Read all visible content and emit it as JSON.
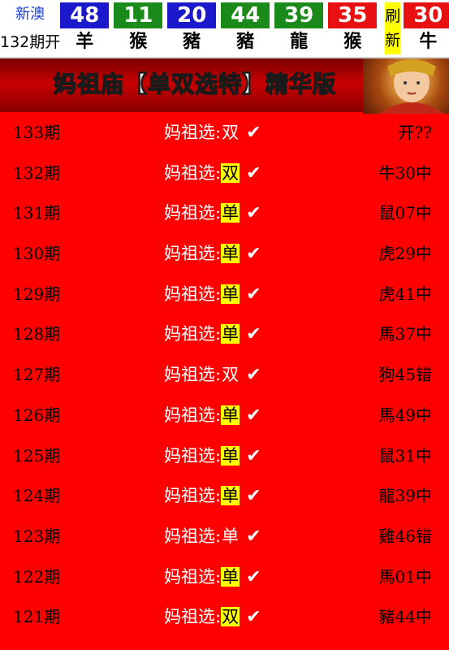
{
  "lottery": {
    "region": "新澳",
    "period": "132期开",
    "balls": [
      {
        "num": "48",
        "zodiac": "羊",
        "color": "blue"
      },
      {
        "num": "11",
        "zodiac": "猴",
        "color": "green"
      },
      {
        "num": "20",
        "zodiac": "豬",
        "color": "blue"
      },
      {
        "num": "44",
        "zodiac": "豬",
        "color": "green"
      },
      {
        "num": "39",
        "zodiac": "龍",
        "color": "green"
      },
      {
        "num": "35",
        "zodiac": "猴",
        "color": "red"
      }
    ],
    "refresh_top": "刷",
    "refresh_bottom": "新",
    "special": {
      "num": "30",
      "zodiac": "牛",
      "color": "red"
    }
  },
  "banner": {
    "title": "妈祖庙【单双选特】精华版"
  },
  "pick_prefix": "妈祖选:",
  "check_glyph": "✔",
  "rows": [
    {
      "period": "133期",
      "pick": "双",
      "highlight": false,
      "result": "开??"
    },
    {
      "period": "132期",
      "pick": "双",
      "highlight": true,
      "result": "牛30中"
    },
    {
      "period": "131期",
      "pick": "单",
      "highlight": true,
      "result": "鼠07中"
    },
    {
      "period": "130期",
      "pick": "单",
      "highlight": true,
      "result": "虎29中"
    },
    {
      "period": "129期",
      "pick": "单",
      "highlight": true,
      "result": "虎41中"
    },
    {
      "period": "128期",
      "pick": "单",
      "highlight": true,
      "result": "馬37中"
    },
    {
      "period": "127期",
      "pick": "双",
      "highlight": false,
      "result": "狗45错"
    },
    {
      "period": "126期",
      "pick": "单",
      "highlight": true,
      "result": "馬49中"
    },
    {
      "period": "125期",
      "pick": "单",
      "highlight": true,
      "result": "鼠31中"
    },
    {
      "period": "124期",
      "pick": "单",
      "highlight": true,
      "result": "龍39中"
    },
    {
      "period": "123期",
      "pick": "单",
      "highlight": false,
      "result": "雞46错"
    },
    {
      "period": "122期",
      "pick": "单",
      "highlight": true,
      "result": "馬01中"
    },
    {
      "period": "121期",
      "pick": "双",
      "highlight": true,
      "result": "豬44中"
    }
  ]
}
